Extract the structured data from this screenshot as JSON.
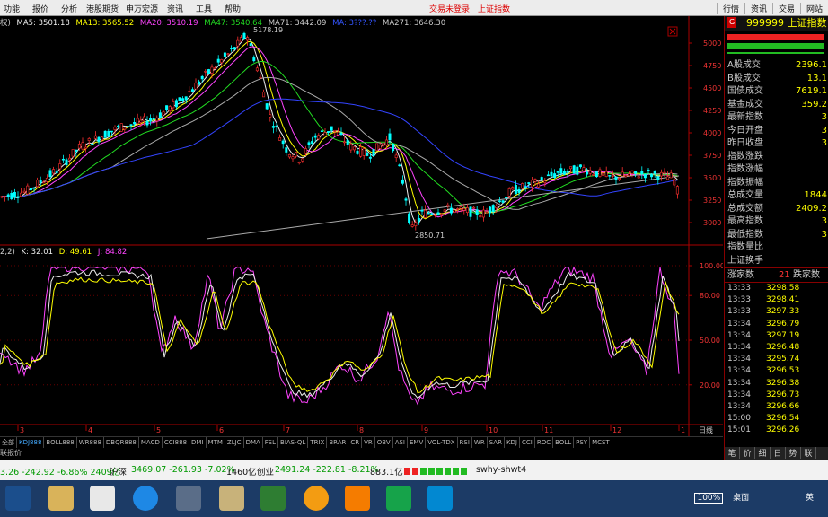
{
  "menu": {
    "items": [
      "功能",
      "报价",
      "分析",
      "港股期货",
      "申万宏源",
      "资讯",
      "工具",
      "帮助"
    ],
    "center": [
      "交易未登录",
      "上证指数"
    ],
    "right": [
      "行情",
      "资讯",
      "交易",
      "网站"
    ]
  },
  "ma_legend": [
    {
      "label": "权)",
      "color": "#cccccc"
    },
    {
      "label": "MA5: 3501.18",
      "color": "#eeeeee"
    },
    {
      "label": "MA13: 3565.52",
      "color": "#ffff00"
    },
    {
      "label": "MA20: 3510.19",
      "color": "#ff44ff"
    },
    {
      "label": "MA47: 3540.64",
      "color": "#22dd22"
    },
    {
      "label": "MA71: 3442.09",
      "color": "#cccccc"
    },
    {
      "label": "MA: 3???.??",
      "color": "#3355ff"
    },
    {
      "label": "MA271: 3646.30",
      "color": "#cccccc"
    }
  ],
  "kdj_legend": [
    {
      "label": "2,2)",
      "color": "#cccccc"
    },
    {
      "label": "K: 32.01",
      "color": "#eeeeee"
    },
    {
      "label": "D: 49.61",
      "color": "#ffff00"
    },
    {
      "label": "J: 84.82",
      "color": "#ff44ff"
    }
  ],
  "main_axis": [
    "5000",
    "4750",
    "4500",
    "4250",
    "4000",
    "3750",
    "3500",
    "3250",
    "3000"
  ],
  "kdj_axis": [
    "100.00",
    "80.00",
    "50.00",
    "20.00"
  ],
  "price_marks": {
    "high": "5178.19",
    "low": "2850.71"
  },
  "month_ticks": [
    "3",
    "4",
    "5",
    "6",
    "7",
    "8",
    "9",
    "10",
    "11",
    "12",
    "1"
  ],
  "period": "日线",
  "tabs": [
    "全部",
    "KDJ888",
    "BOLL888",
    "WR888",
    "DBQR888",
    "MACD",
    "CCI888",
    "DMI",
    "MTM",
    "ZLJC",
    "DMA",
    "FSL",
    "BIAS-QL",
    "TRIX",
    "BRAR",
    "CR",
    "VR",
    "OBV",
    "ASI",
    "EMV",
    "VOL-TDX",
    "RSI",
    "WR",
    "SAR",
    "KDJ",
    "CCI",
    "ROC",
    "BOLL",
    "PSY",
    "MCST"
  ],
  "subbar_label": "联报价",
  "panel": {
    "badge": "G",
    "code_name": "999999 上证指数",
    "rows": [
      {
        "label": "A股成交",
        "value": "2396.1"
      },
      {
        "label": "B股成交",
        "value": "13.1"
      },
      {
        "label": "国债成交",
        "value": "7619.1"
      },
      {
        "label": "基金成交",
        "value": "359.2"
      },
      {
        "label": "最新指数",
        "value": "3"
      },
      {
        "label": "今日开盘",
        "value": "3"
      },
      {
        "label": "昨日收盘",
        "value": "3"
      },
      {
        "label": "指数涨跌",
        "value": ""
      },
      {
        "label": "指数涨幅",
        "value": ""
      },
      {
        "label": "指数振幅",
        "value": ""
      },
      {
        "label": "总成交量",
        "value": "1844"
      },
      {
        "label": "总成交额",
        "value": "2409.2"
      },
      {
        "label": "最高指数",
        "value": "3"
      },
      {
        "label": "最低指数",
        "value": "3"
      },
      {
        "label": "指数量比",
        "value": ""
      },
      {
        "label": "上证换手",
        "value": ""
      }
    ],
    "updown": {
      "up_label": "涨家数",
      "up_value": "21",
      "down_label": "跌家数"
    },
    "ticks": [
      {
        "t": "13:33",
        "p": "3298.58"
      },
      {
        "t": "13:33",
        "p": "3298.41"
      },
      {
        "t": "13:33",
        "p": "3297.33"
      },
      {
        "t": "13:34",
        "p": "3296.79"
      },
      {
        "t": "13:34",
        "p": "3297.19"
      },
      {
        "t": "13:34",
        "p": "3296.48"
      },
      {
        "t": "13:34",
        "p": "3295.74"
      },
      {
        "t": "13:34",
        "p": "3296.53"
      },
      {
        "t": "13:34",
        "p": "3296.38"
      },
      {
        "t": "13:34",
        "p": "3296.73"
      },
      {
        "t": "13:34",
        "p": "3296.66"
      },
      {
        "t": "15:00",
        "p": "3296.54"
      },
      {
        "t": "15:01",
        "p": "3296.26"
      }
    ],
    "bottom_tabs": [
      "笔",
      "价",
      "细",
      "日",
      "势",
      "联"
    ]
  },
  "statusbar": {
    "seg1": "3.26 -242.92 -6.86% 2409亿",
    "seg2_label": "沪深",
    "seg2": "3469.07 -261.93 -7.02%",
    "seg2_amt": "1460亿",
    "seg3_label": "创业",
    "seg3": "2491.24 -222.81 -8.21%",
    "seg3_amt": "883.1亿",
    "server": "swhy-shwt4"
  },
  "taskbar": {
    "battery": "100%",
    "desktop": "桌面",
    "ime": "英"
  },
  "colors": {
    "up": "#ff3030",
    "down": "#00ffff",
    "k": "#eeeeee",
    "d": "#ffff00",
    "j": "#ff44ff",
    "grid": "#7a0000"
  }
}
